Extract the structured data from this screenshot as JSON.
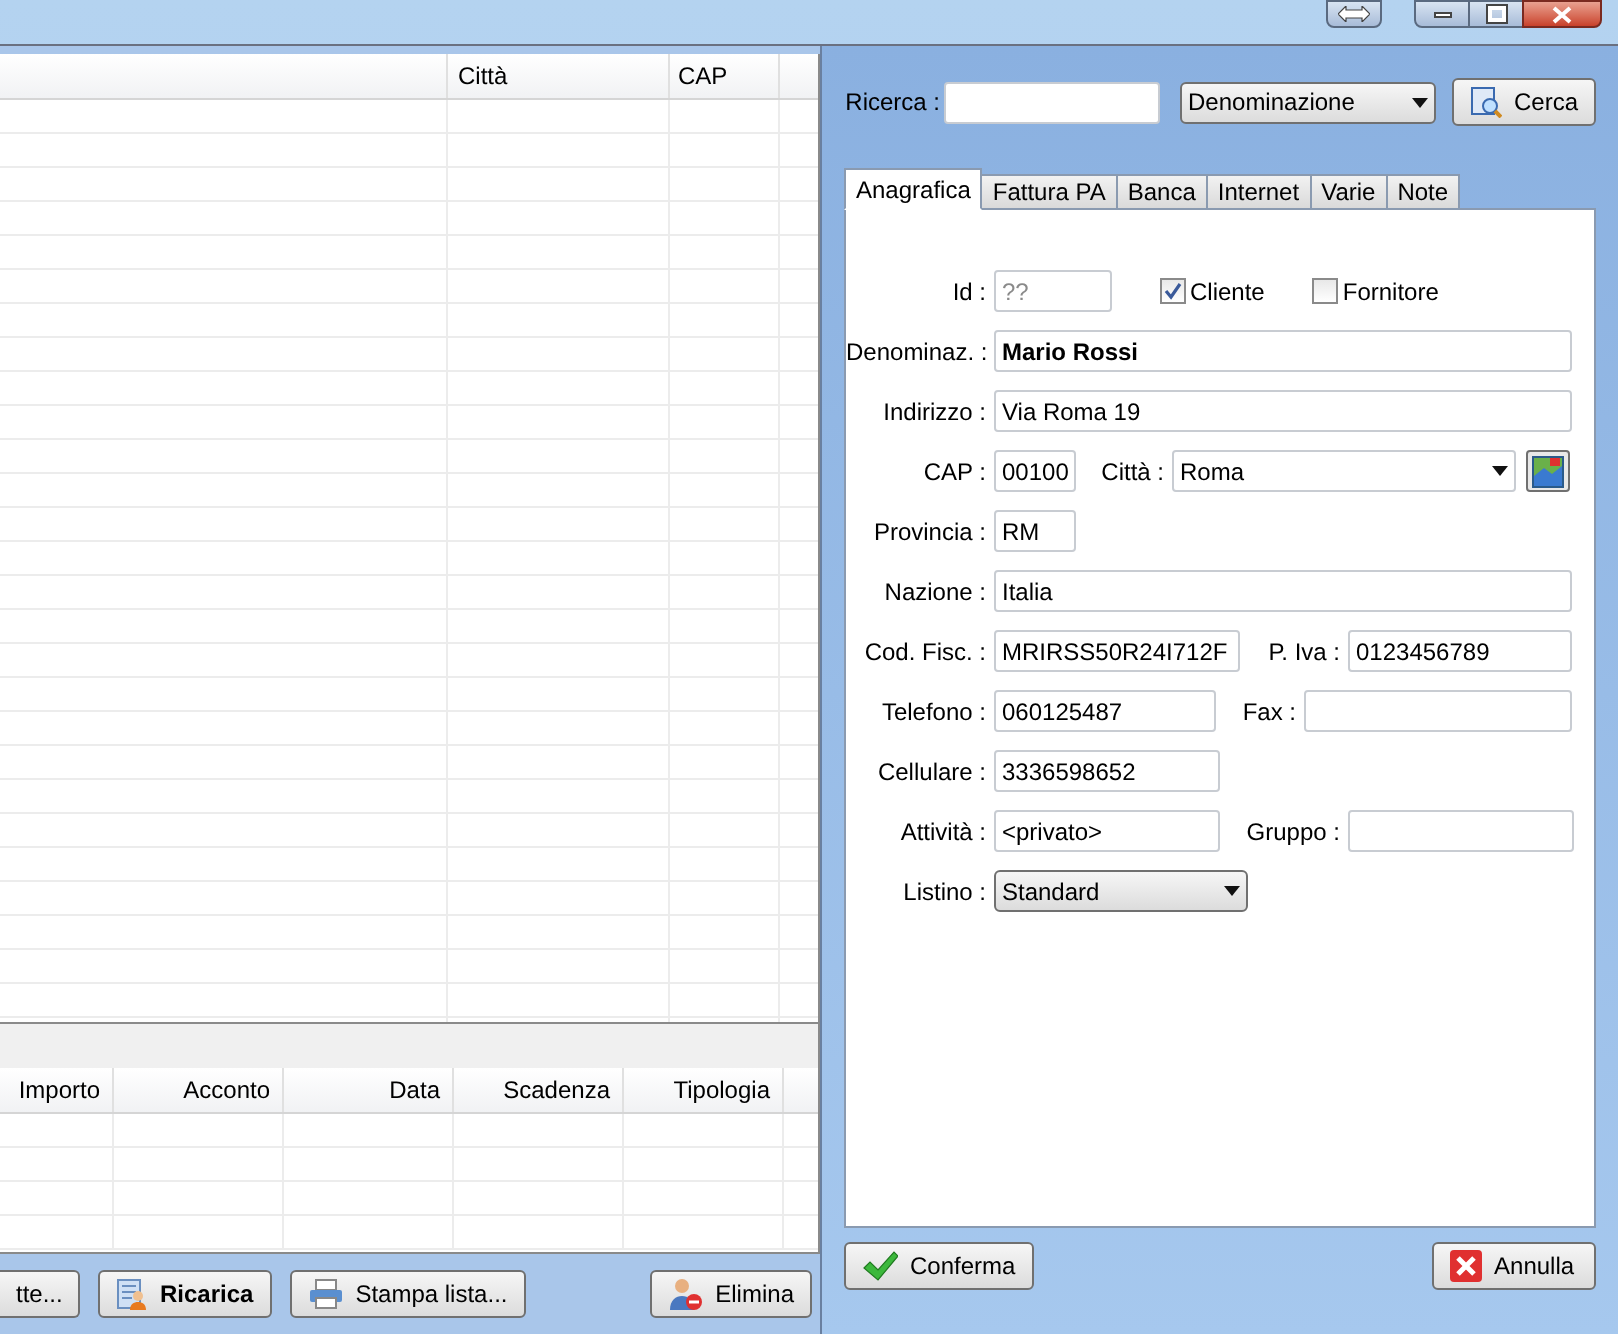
{
  "list_table": {
    "columns": [
      "Città",
      "CAP"
    ]
  },
  "payments_table": {
    "columns": [
      "Importo",
      "Acconto",
      "Data",
      "Scadenza",
      "Tipologia"
    ]
  },
  "list_buttons": [
    {
      "label": "tte...",
      "kind": "plain",
      "emphasized": false
    },
    {
      "label": "Ricarica",
      "kind": "reload",
      "emphasized": true
    },
    {
      "label": "Stampa lista...",
      "kind": "print",
      "emphasized": false
    },
    {
      "label": "Elimina",
      "kind": "delete",
      "emphasized": false
    }
  ],
  "search": {
    "label": "Ricerca :",
    "field": "Denominazione",
    "button": "Cerca"
  },
  "tabs": [
    {
      "label": "Anagrafica",
      "selected": true
    },
    {
      "label": "Fattura PA",
      "selected": false
    },
    {
      "label": "Banca",
      "selected": false
    },
    {
      "label": "Internet",
      "selected": false
    },
    {
      "label": "Varie",
      "selected": false
    },
    {
      "label": "Note",
      "selected": false
    }
  ],
  "form": {
    "id": {
      "label": "Id :",
      "placeholder": "??"
    },
    "cliente": {
      "label": "Cliente",
      "checked": true
    },
    "fornitore": {
      "label": "Fornitore",
      "checked": false
    },
    "denominazione": {
      "label": "Denominaz. :",
      "value": "Mario Rossi"
    },
    "indirizzo": {
      "label": "Indirizzo :",
      "value": "Via Roma 19"
    },
    "cap": {
      "label": "CAP :",
      "value": "00100"
    },
    "citta": {
      "label": "Città :",
      "value": "Roma"
    },
    "provincia": {
      "label": "Provincia :",
      "value": "RM"
    },
    "nazione": {
      "label": "Nazione :",
      "value": "Italia"
    },
    "cod_fisc": {
      "label": "Cod. Fisc. :",
      "value": "MRIRSS50R24I712F"
    },
    "p_iva": {
      "label": "P. Iva :",
      "value": "0123456789"
    },
    "telefono": {
      "label": "Telefono :",
      "value": "060125487"
    },
    "fax": {
      "label": "Fax :"
    },
    "cellulare": {
      "label": "Cellulare :",
      "value": "3336598652"
    },
    "attivita": {
      "label": "Attività :",
      "value": "<privato>"
    },
    "gruppo": {
      "label": "Gruppo :"
    },
    "listino": {
      "label": "Listino :",
      "value": "Standard"
    }
  },
  "dialog_buttons": [
    {
      "label": "Conferma",
      "kind": "confirm"
    },
    {
      "label": "Annulla",
      "kind": "cancel"
    }
  ]
}
